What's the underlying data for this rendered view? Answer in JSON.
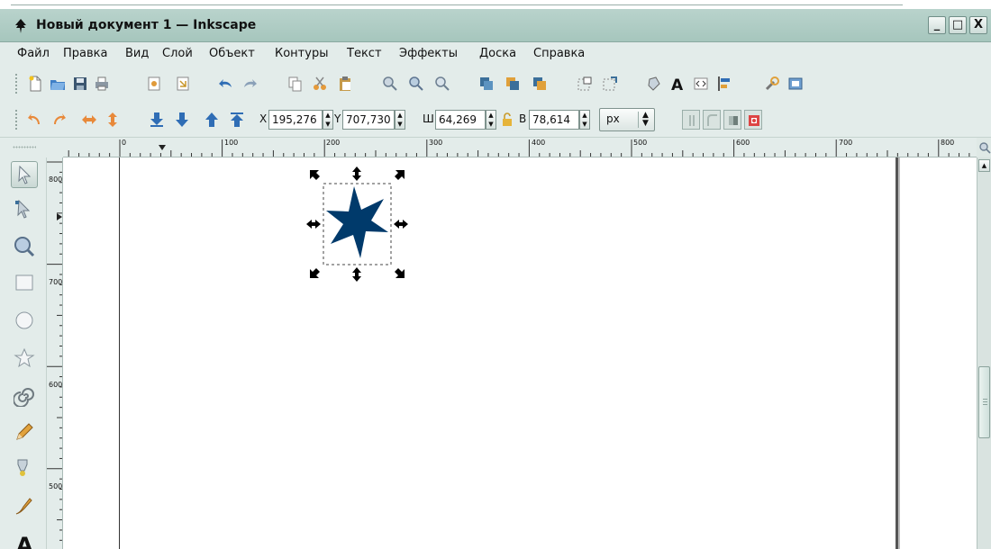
{
  "window": {
    "title": "Новый документ 1 — Inkscape",
    "minimize": "_",
    "maximize": "□",
    "close": "X"
  },
  "menu": [
    "Файл",
    "Правка",
    "Вид",
    "Слой",
    "Объект",
    "Контуры",
    "Текст",
    "Эффекты",
    "Доска",
    "Справка"
  ],
  "selection_toolbar": {
    "x_label": "X",
    "x_value": "195,276",
    "y_label": "Y",
    "y_value": "707,730",
    "w_label": "Ш",
    "w_value": "64,269",
    "h_label": "В",
    "h_value": "78,614",
    "unit": "px"
  },
  "ruler": {
    "h_labels": [
      "0",
      "100",
      "200",
      "300",
      "400",
      "500",
      "600",
      "700",
      "800"
    ],
    "v_labels": [
      "800",
      "700",
      "600",
      "500"
    ]
  },
  "object": {
    "shape": "star",
    "color": "#003a6b"
  },
  "colors": {
    "accent": "#003a6b",
    "chrome": "#e3ecea",
    "titlebar": "#b0ccc5"
  }
}
